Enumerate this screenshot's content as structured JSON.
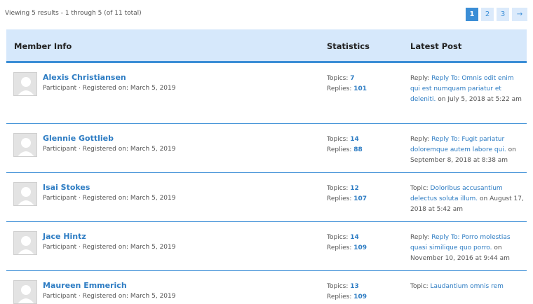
{
  "results_text": "Viewing 5 results - 1 through 5 (of 11 total)",
  "pagination": {
    "pages": [
      "1",
      "2",
      "3"
    ],
    "current": "1",
    "next": "→"
  },
  "columns": {
    "member": "Member Info",
    "stats": "Statistics",
    "latest": "Latest Post"
  },
  "labels": {
    "topics": "Topics:",
    "replies": "Replies:",
    "on": "on"
  },
  "members": [
    {
      "name": "Alexis Christiansen",
      "meta": "Participant · Registered on: March 5, 2019",
      "topics": "7",
      "replies": "101",
      "post_prefix": "Reply:",
      "post_title": "Reply To: Omnis odit enim qui est numquam pariatur et deleniti.",
      "post_date": "July 5, 2018 at 5:22 am"
    },
    {
      "name": "Glennie Gottlieb",
      "meta": "Participant · Registered on: March 5, 2019",
      "topics": "14",
      "replies": "88",
      "post_prefix": "Reply:",
      "post_title": "Reply To: Fugit pariatur doloremque autem labore qui.",
      "post_date": "September 8, 2018 at 8:38 am"
    },
    {
      "name": "Isai Stokes",
      "meta": "Participant · Registered on: March 5, 2019",
      "topics": "12",
      "replies": "107",
      "post_prefix": "Topic:",
      "post_title": "Doloribus accusantium delectus soluta illum.",
      "post_date": "August 17, 2018 at 5:42 am"
    },
    {
      "name": "Jace Hintz",
      "meta": "Participant · Registered on: March 5, 2019",
      "topics": "14",
      "replies": "109",
      "post_prefix": "Reply:",
      "post_title": "Reply To: Porro molestias quasi similique quo porro.",
      "post_date": "November 10, 2016 at 9:44 am"
    },
    {
      "name": "Maureen Emmerich",
      "meta": "Participant · Registered on: March 5, 2019",
      "topics": "13",
      "replies": "109",
      "post_prefix": "Topic:",
      "post_title": "Laudantium omnis rem",
      "post_date": ""
    }
  ]
}
